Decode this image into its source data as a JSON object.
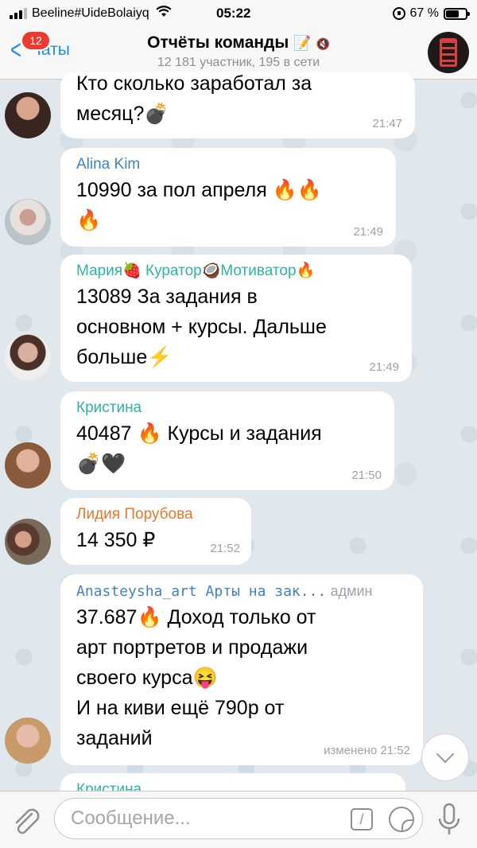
{
  "status_bar": {
    "carrier": "Beeline#UideBolaiyq",
    "time": "05:22",
    "battery": "67 %",
    "battery_level": 0.67
  },
  "nav": {
    "back_label": "Чаты",
    "unread_badge": "12",
    "title": "Отчёты команды",
    "title_emoji": "📝",
    "subtitle": "12 181 участник, 195 в сети"
  },
  "messages": [
    {
      "sender": "",
      "text_lines": [
        "Кто сколько заработал за",
        "месяц?💣"
      ],
      "time": "21:47"
    },
    {
      "sender": "Alina Kim",
      "sender_color": "#3f82c4",
      "text_lines": [
        "10990  за пол апреля 🔥🔥",
        "🔥"
      ],
      "time": "21:49"
    },
    {
      "sender": "Мария🍓 Куратор🥥Мотиватор🔥",
      "sender_color": "#2eb3a3",
      "text_lines": [
        "13089 За задания в",
        "основном + курсы. Дальше",
        "больше⚡"
      ],
      "time": "21:49"
    },
    {
      "sender": "Кристина",
      "sender_color": "#2eb3a3",
      "text_lines": [
        "40487 🔥 Курсы и задания",
        "💣🖤"
      ],
      "time": "21:50"
    },
    {
      "sender": "Лидия Порубова",
      "sender_color": "#e27a2b",
      "text_lines": [
        "14 350 ₽"
      ],
      "time": "21:52"
    },
    {
      "sender": "Anasteysha_art Арты на зак...",
      "sender_color": "#3f82c4",
      "sender_role": "админ",
      "text_lines": [
        "37.687🔥 Доход только от",
        "арт портретов и продажи",
        "своего курса😝",
        "И на киви ещё 790р от",
        "заданий"
      ],
      "time": "изменено 21:52"
    },
    {
      "sender": "Кристина",
      "sender_color": "#2eb3a3",
      "text_lines": [],
      "time": ""
    }
  ],
  "input": {
    "placeholder": "Сообщение..."
  },
  "icons": {
    "back": "chevron-left-icon",
    "attach": "paperclip-icon",
    "commands": "slash-command-icon",
    "sticker": "sticker-icon",
    "mic": "microphone-icon",
    "scroll": "chevron-down-icon"
  }
}
